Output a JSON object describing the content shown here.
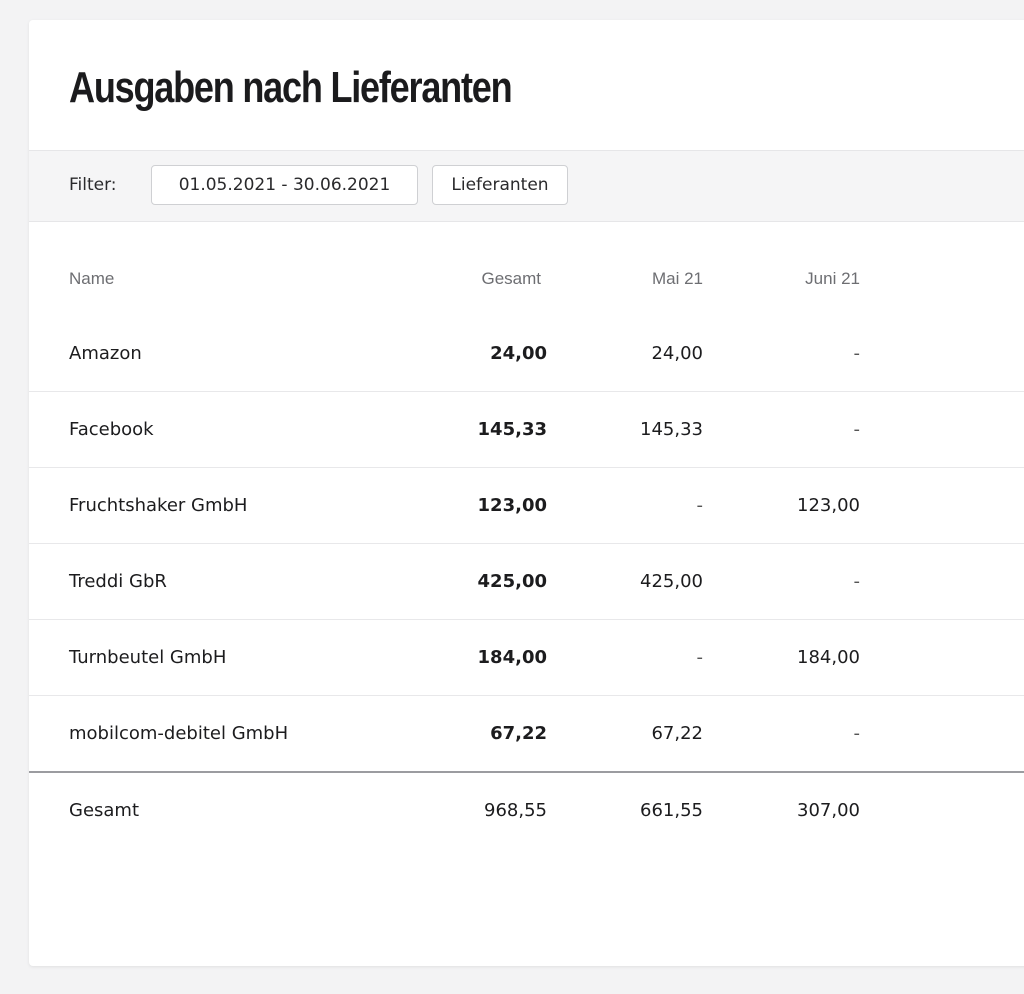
{
  "page": {
    "title": "Ausgaben nach Lieferanten"
  },
  "filter": {
    "label": "Filter:",
    "date_range": "01.05.2021 - 30.06.2021",
    "supplier_button": "Lieferanten"
  },
  "table": {
    "columns": [
      "Name",
      "Gesamt",
      "Mai 21",
      "Juni 21"
    ],
    "rows": [
      {
        "name": "Amazon",
        "total": "24,00",
        "may": "24,00",
        "june": "-"
      },
      {
        "name": "Facebook",
        "total": "145,33",
        "may": "145,33",
        "june": "-"
      },
      {
        "name": "Fruchtshaker GmbH",
        "total": "123,00",
        "may": "-",
        "june": "123,00"
      },
      {
        "name": "Treddi GbR",
        "total": "425,00",
        "may": "425,00",
        "june": "-"
      },
      {
        "name": "Turnbeutel GmbH",
        "total": "184,00",
        "may": "-",
        "june": "184,00"
      },
      {
        "name": "mobilcom-debitel GmbH",
        "total": "67,22",
        "may": "67,22",
        "june": "-"
      }
    ],
    "totals": {
      "name": "Gesamt",
      "total": "968,55",
      "may": "661,55",
      "june": "307,00"
    }
  }
}
